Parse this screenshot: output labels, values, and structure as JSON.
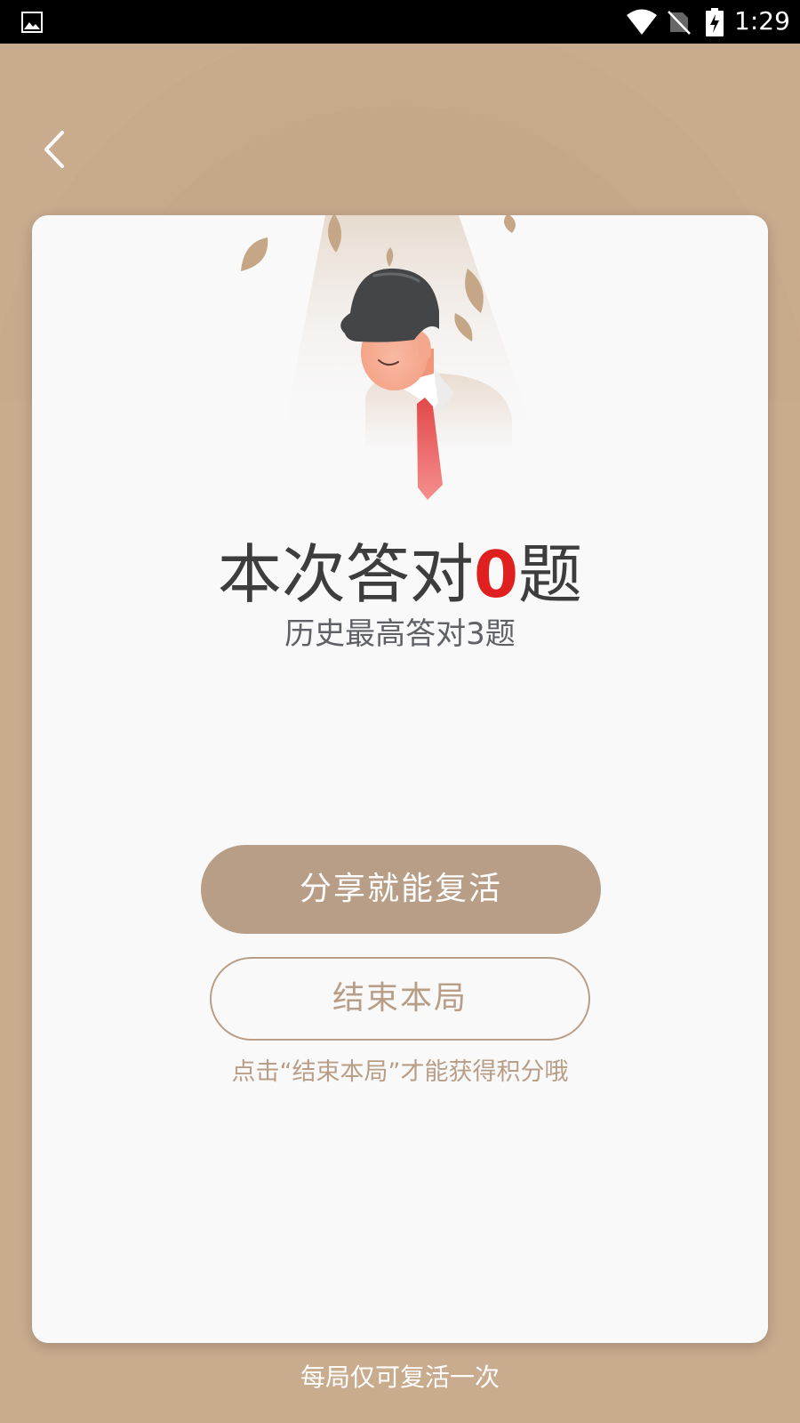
{
  "status_bar": {
    "time": "1:29",
    "icons": [
      "gallery-icon",
      "wifi-icon",
      "no-sim-icon",
      "battery-charging-icon"
    ]
  },
  "nav": {
    "back_icon": "chevron-left-icon"
  },
  "result": {
    "prefix": "本次答对",
    "count": "0",
    "suffix": "题",
    "best_text": "历史最高答对3题"
  },
  "actions": {
    "share_label": "分享就能复活",
    "end_label": "结束本局",
    "hint": "点击“结束本局”才能获得积分哦"
  },
  "footer": {
    "note": "每局仅可复活一次"
  },
  "colors": {
    "background": "#c9ab8e",
    "card": "#f9f9fa",
    "accent": "#b89e86",
    "highlight": "#e0201f",
    "title_text": "#3d3d3d",
    "subtitle_text": "#5f6166"
  }
}
